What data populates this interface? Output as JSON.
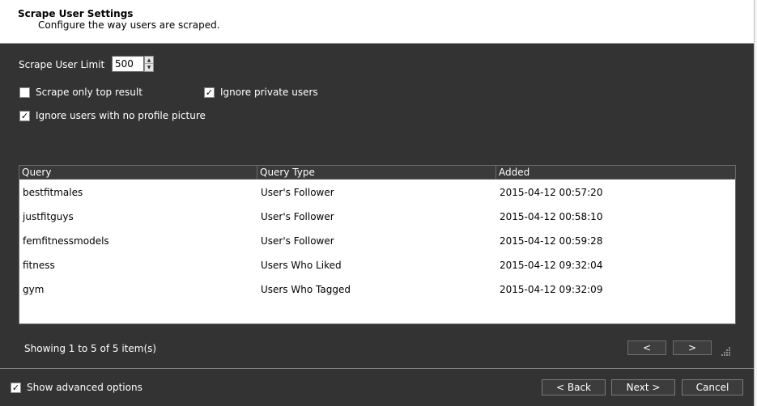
{
  "header": {
    "title": "Scrape User Settings",
    "subtitle": "Configure the way users are scraped."
  },
  "settings": {
    "limit_label": "Scrape User Limit",
    "limit_value": "500",
    "options": [
      {
        "label": "Scrape only top result",
        "checked": false
      },
      {
        "label": "Ignore private users",
        "checked": true
      },
      {
        "label": "Ignore users with no profile picture",
        "checked": true
      }
    ]
  },
  "table": {
    "columns": [
      "Query",
      "Query Type",
      "Added"
    ],
    "rows": [
      {
        "query": "bestfitmales",
        "type": "User's Follower",
        "added": "2015-04-12 00:57:20"
      },
      {
        "query": "justfitguys",
        "type": "User's Follower",
        "added": "2015-04-12 00:58:10"
      },
      {
        "query": "femfitnessmodels",
        "type": "User's Follower",
        "added": "2015-04-12 00:59:28"
      },
      {
        "query": "fitness",
        "type": "Users Who Liked",
        "added": "2015-04-12 09:32:04"
      },
      {
        "query": "gym",
        "type": "Users Who Tagged",
        "added": "2015-04-12 09:32:09"
      }
    ]
  },
  "pager": {
    "text": "Showing 1 to 5 of 5 item(s)",
    "prev_label": "<",
    "next_label": ">"
  },
  "footer": {
    "advanced_label": "Show advanced options",
    "advanced_checked": true,
    "back_label": "< Back",
    "next_label": "Next >",
    "cancel_label": "Cancel"
  },
  "icons": {
    "check": "check-icon",
    "spin_up": "chevron-up-icon",
    "spin_down": "chevron-down-icon",
    "grip": "resize-grip-icon"
  },
  "colors": {
    "panel_bg": "#333333",
    "header_bg": "#ffffff",
    "grid_bg": "#ffffff",
    "grid_header_bg": "#3a3a3a"
  }
}
